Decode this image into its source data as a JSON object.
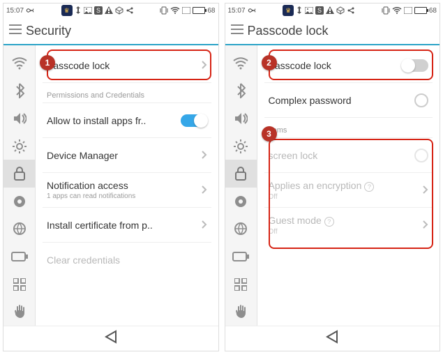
{
  "status": {
    "time": "15:07",
    "battery": "68"
  },
  "left": {
    "title": "Security",
    "step": "1",
    "rows": {
      "passcode": "Passcode lock",
      "section_perm": "Permissions and Credentials",
      "install_apps": "Allow to install apps fr..",
      "device_manager": "Device Manager",
      "notif_access": "Notification access",
      "notif_sub": "1 apps can read notifications",
      "install_cert": "Install certificate from p..",
      "clear_cred": "Clear credentials"
    }
  },
  "right": {
    "title": "Passcode lock",
    "step2": "2",
    "step3": "3",
    "rows": {
      "passcode": "Passcode lock",
      "complex": "Complex password",
      "section_items": "Items",
      "screen_lock": "screen lock",
      "enc": "Applies an encryption",
      "enc_sub": "Off",
      "guest": "Guest mode",
      "guest_sub": "Off"
    }
  }
}
